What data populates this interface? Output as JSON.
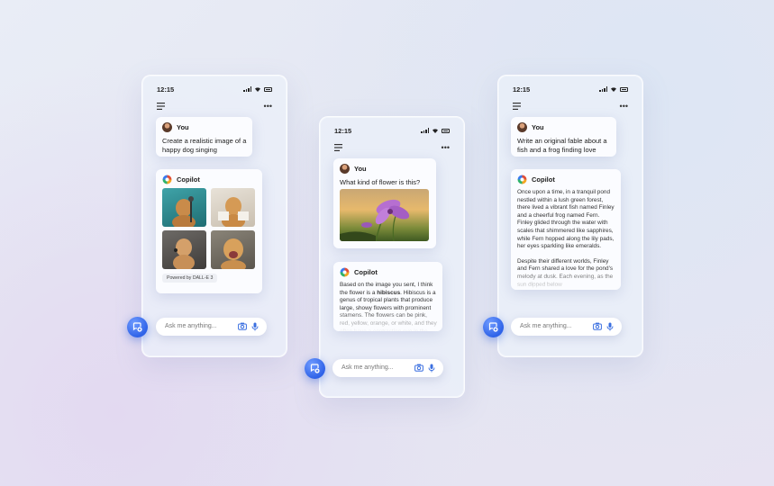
{
  "phones": [
    {
      "time": "12:15",
      "user_name": "You",
      "user_message": "Create a realistic image of a happy dog singing",
      "bot_name": "Copilot",
      "powered_by": "Powered by DALL-E 3",
      "input_placeholder": "Ask me anything..."
    },
    {
      "time": "12:15",
      "user_name": "You",
      "user_message": "What kind of flower is this?",
      "bot_name": "Copilot",
      "reply_before": "Based on the image you sent, I think the flower is a ",
      "reply_bold": "hibiscus",
      "reply_after": ". Hibiscus is a genus of tropical plants that produce large, showy flowers with prominent stamens. The flowers can be pink, red, yellow, orange, or white, and they often have a contrasting eye in the",
      "input_placeholder": "Ask me anything..."
    },
    {
      "time": "12:15",
      "user_name": "You",
      "user_message": "Write an original fable about a fish and a frog finding love",
      "bot_name": "Copilot",
      "reply_p1": "Once upon a time, in a tranquil pond nestled within a lush green forest, there lived a vibrant fish named Finley and a cheerful frog named Fern. Finley glided through the water with scales that shimmered like sapphires, while Fern hopped along the lily pads, her eyes sparkling like emeralds.",
      "reply_p2": "Despite their different worlds, Finley and Fern shared a love for the pond's melody at dusk. Each evening, as the sun dipped below",
      "input_placeholder": "Ask me anything..."
    }
  ],
  "colors": {
    "accent": "#2f63e8",
    "card": "#fbfcff",
    "background": "#e6e8f4"
  },
  "icons": [
    "signal-icon",
    "wifi-icon",
    "battery-icon",
    "menu-icon",
    "more-icon",
    "copilot-logo-icon",
    "camera-icon",
    "microphone-icon",
    "new-chat-icon"
  ]
}
